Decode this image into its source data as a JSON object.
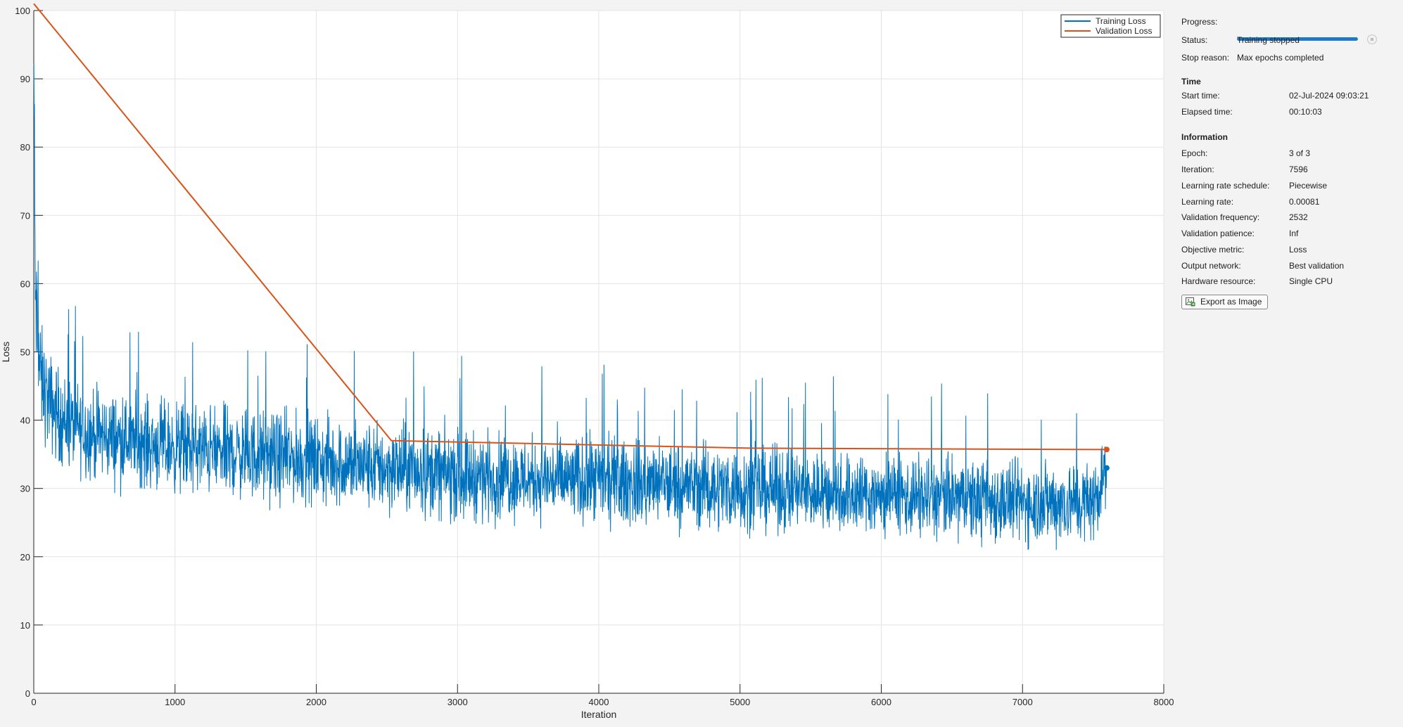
{
  "chart_data": {
    "type": "line",
    "xlabel": "Iteration",
    "ylabel": "Loss",
    "xlim": [
      0,
      8000
    ],
    "ylim": [
      0,
      100
    ],
    "xticks": [
      0,
      1000,
      2000,
      3000,
      4000,
      5000,
      6000,
      7000,
      8000
    ],
    "yticks": [
      0,
      10,
      20,
      30,
      40,
      50,
      60,
      70,
      80,
      90,
      100
    ],
    "grid": true,
    "legend": {
      "position": "top-right",
      "entries": [
        "Training Loss",
        "Validation Loss"
      ]
    },
    "series": [
      {
        "name": "Training Loss",
        "color": "#0072bd",
        "note_points_sampled": false,
        "x": [
          1,
          10,
          25,
          50,
          100,
          200,
          400,
          700,
          1000,
          1500,
          2000,
          2500,
          3000,
          3500,
          4000,
          4500,
          5000,
          5500,
          6000,
          6500,
          7000,
          7500,
          7596
        ],
        "y": [
          91,
          60,
          52,
          46,
          43,
          40,
          38,
          37,
          36,
          35,
          34,
          33,
          32,
          31.5,
          31,
          30.5,
          30,
          29.5,
          29,
          28.5,
          28,
          28,
          33
        ],
        "band_low": [
          55,
          40,
          38,
          34,
          33,
          32,
          31,
          30,
          29,
          28,
          27,
          26,
          25,
          25,
          24,
          24,
          24,
          23,
          23,
          23,
          23,
          23,
          23
        ],
        "band_high": [
          91,
          67,
          63,
          55,
          52,
          50,
          48,
          47,
          46,
          45,
          44,
          43,
          42,
          41,
          41,
          40,
          40,
          39,
          39,
          39,
          39,
          39,
          35
        ],
        "last_point": [
          7596,
          33
        ]
      },
      {
        "name": "Validation Loss",
        "color": "#d95319",
        "x": [
          0,
          2532,
          5064,
          7596
        ],
        "y": [
          101,
          37,
          35.9,
          35.7
        ],
        "last_point": [
          7596,
          35.7
        ]
      }
    ]
  },
  "info": {
    "progress_label": "Progress:",
    "progress_value": 1.0,
    "status_label": "Status:",
    "status_value": "Training stopped",
    "stop_reason_label": "Stop reason:",
    "stop_reason_value": "Max epochs completed",
    "time_title": "Time",
    "start_time_label": "Start time:",
    "start_time_value": "02-Jul-2024 09:03:21",
    "elapsed_time_label": "Elapsed time:",
    "elapsed_time_value": "00:10:03",
    "information_title": "Information",
    "rows": [
      {
        "label": "Epoch:",
        "value": "3 of 3"
      },
      {
        "label": "Iteration:",
        "value": "7596"
      },
      {
        "label": "Learning rate schedule:",
        "value": "Piecewise"
      },
      {
        "label": "Learning rate:",
        "value": "0.00081"
      },
      {
        "label": "Validation frequency:",
        "value": "2532"
      },
      {
        "label": "Validation patience:",
        "value": "Inf"
      },
      {
        "label": "Objective metric:",
        "value": "Loss"
      },
      {
        "label": "Output network:",
        "value": "Best validation"
      },
      {
        "label": "Hardware resource:",
        "value": "Single CPU"
      }
    ],
    "export_button_label": "Export as Image",
    "export_icon": "image-export-icon",
    "stop_icon": "stop-icon"
  }
}
